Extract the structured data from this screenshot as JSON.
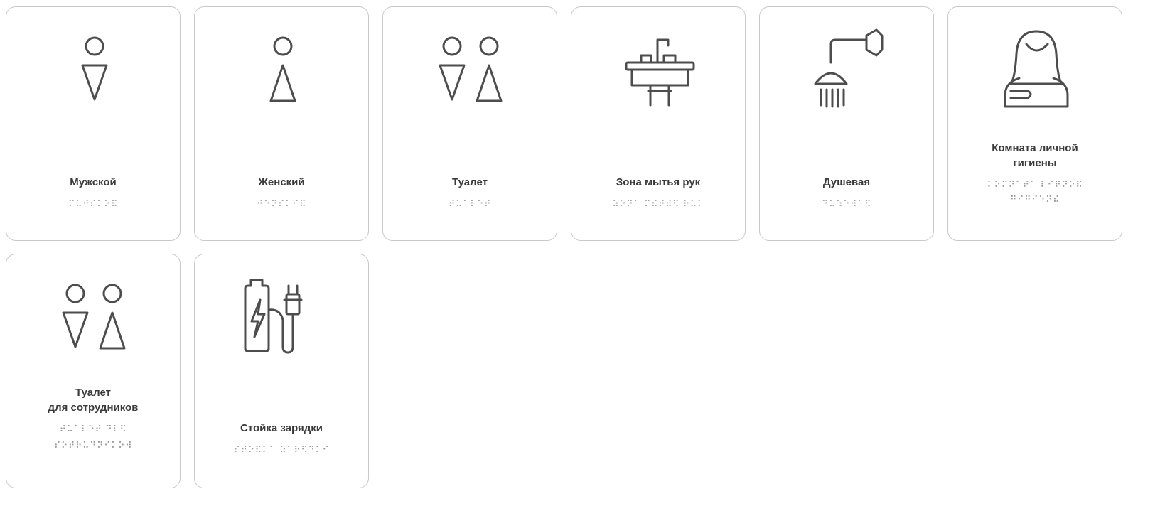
{
  "cards": [
    {
      "title": "Мужской",
      "braille": "⠍⠥⠚⠎⠅⠕⠯",
      "icon": "male-icon"
    },
    {
      "title": "Женский",
      "braille": "⠚⠑⠝⠎⠅⠊⠯",
      "icon": "female-icon"
    },
    {
      "title": "Туалет",
      "braille": "⠞⠥⠁⠇⠑⠞",
      "icon": "toilet-icon"
    },
    {
      "title": "Зона мытья рук",
      "braille": "⠵⠕⠝⠁ ⠍⠮⠞⠾⠫ ⠗⠥⠅",
      "icon": "sink-icon"
    },
    {
      "title": "Душевая",
      "braille": "⠙⠥⠱⠑⠺⠁⠫",
      "icon": "shower-icon"
    },
    {
      "title_line1": "Комната личной",
      "title_line2": "гигиены",
      "braille_line1": "⠅⠕⠍⠝⠁⠞⠁ ⠇⠊⠟⠝⠕⠯",
      "braille_line2": "⠛⠊⠛⠊⠑⠝⠮",
      "icon": "woman-icon"
    },
    {
      "title_line1": "Туалет",
      "title_line2": "для сотрудников",
      "braille_line1": "⠞⠥⠁⠇⠑⠞ ⠙⠇⠫",
      "braille_line2": "⠎⠕⠞⠗⠥⠙⠝⠊⠅⠕⠺",
      "icon": "staff-toilet-icon"
    },
    {
      "title": "Стойка зарядки",
      "braille": "⠎⠞⠕⠯⠅⠁ ⠵⠁⠗⠫⠙⠅⠊",
      "icon": "charging-icon"
    }
  ]
}
